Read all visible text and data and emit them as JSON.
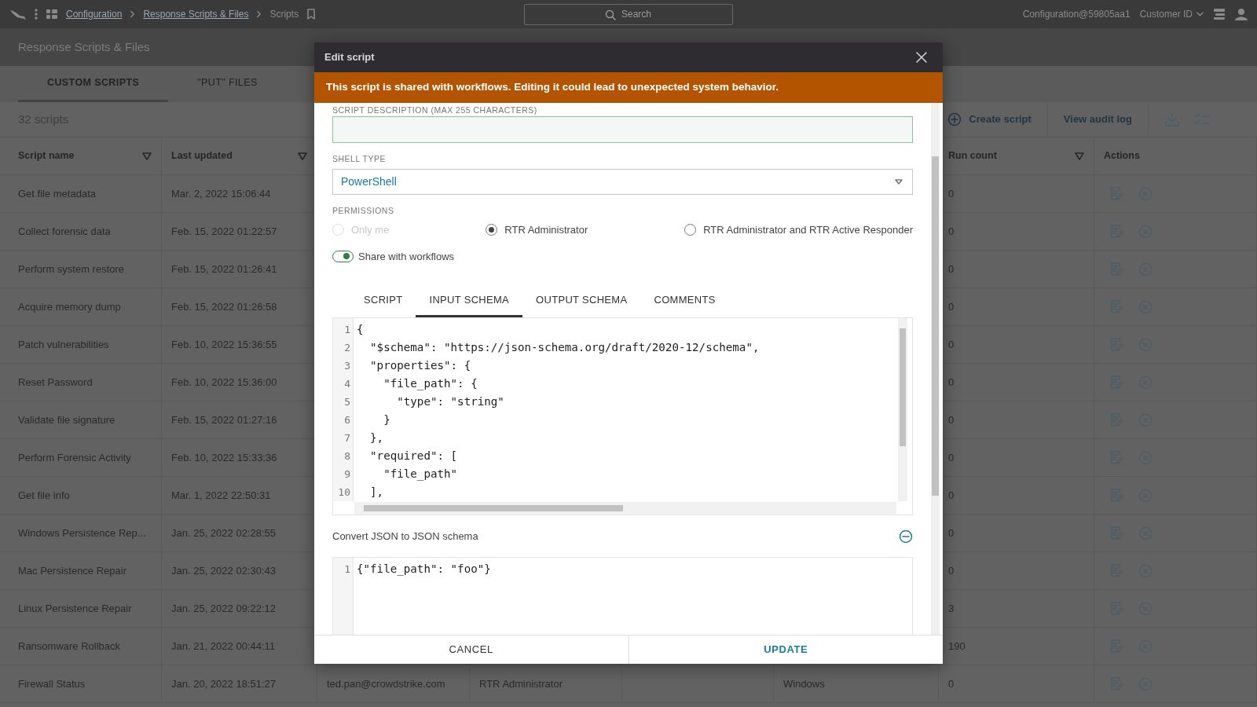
{
  "top_bar": {
    "breadcrumb": [
      {
        "label": "Configuration",
        "link": true
      },
      {
        "label": "Response Scripts & Files",
        "link": true
      },
      {
        "label": "Scripts",
        "link": false
      }
    ],
    "search": {
      "placeholder": "Search"
    },
    "account": "Configuration@59805aa1",
    "customer_menu": "Customer ID"
  },
  "page_title": "Response Scripts & Files",
  "tabs": [
    {
      "label": "CUSTOM SCRIPTS",
      "selected": true
    },
    {
      "label": "\"PUT\" FILES",
      "selected": false
    }
  ],
  "toolbar": {
    "count": "32 scripts",
    "create": "Create script",
    "audit": "View audit log"
  },
  "table": {
    "columns": [
      {
        "label": "Script name",
        "sortable": true
      },
      {
        "label": "Last updated",
        "sortable": true
      },
      {
        "label": "Run count",
        "sortable": true
      },
      {
        "label": "Actions",
        "sortable": false
      }
    ],
    "rows": [
      {
        "script_name": "Get file metadata",
        "last_updated": "Mar. 2, 2022 15:06:44",
        "run_count": "0"
      },
      {
        "script_name": "Collect forensic data",
        "last_updated": "Feb. 15, 2022 01:22:57",
        "run_count": "0"
      },
      {
        "script_name": "Perform system restore",
        "last_updated": "Feb. 15, 2022 01:26:41",
        "run_count": "0"
      },
      {
        "script_name": "Acquire memory dump",
        "last_updated": "Feb. 15, 2022 01:26:58",
        "run_count": "0"
      },
      {
        "script_name": "Patch vulnerabilities",
        "last_updated": "Feb. 10, 2022 15:36:55",
        "run_count": "0"
      },
      {
        "script_name": "Reset Password",
        "last_updated": "Feb. 10, 2022 15:36:00",
        "run_count": "0"
      },
      {
        "script_name": "Validate file signature",
        "last_updated": "Feb. 15, 2022 01:27:16",
        "run_count": "0"
      },
      {
        "script_name": "Perform Forensic Activity",
        "last_updated": "Feb. 10, 2022 15:33:36",
        "run_count": "0"
      },
      {
        "script_name": "Get file info",
        "last_updated": "Mar. 1, 2022 22:50:31",
        "run_count": "0"
      },
      {
        "script_name": "Windows Persistence Rep...",
        "last_updated": "Jan. 25, 2022 02:28:55",
        "run_count": "0"
      },
      {
        "script_name": "Mac Persistence Repair",
        "last_updated": "Jan. 25, 2022 02:30:43",
        "run_count": "0"
      },
      {
        "script_name": "Linux Persistence Repair",
        "last_updated": "Jan. 25, 2022 09:22:12",
        "run_count": "3"
      },
      {
        "script_name": "Ransomware Rollback",
        "last_updated": "Jan. 21, 2022 00:44:11",
        "run_count": "190"
      },
      {
        "script_name": "Firewall Status",
        "last_updated": "Jan. 20, 2022 18:51:27",
        "column_3": "ted.pan@crowdstrike.com",
        "column_4": "RTR Administrator",
        "column_6": "Windows",
        "run_count": "0"
      }
    ]
  },
  "modal": {
    "title": "Edit script",
    "warning": "This script is shared with workflows. Editing it could lead to unexpected system behavior.",
    "description": {
      "label": "SCRIPT DESCRIPTION (MAX 255 CHARACTERS)"
    },
    "shell": {
      "label": "SHELL TYPE",
      "value": "PowerShell"
    },
    "permissions": {
      "label": "PERMISSIONS",
      "options": [
        {
          "label": "Only me",
          "selected": false,
          "disabled": true
        },
        {
          "label": "RTR Administrator",
          "selected": true,
          "disabled": false
        },
        {
          "label": "RTR Administrator and RTR Active Responder",
          "selected": false,
          "disabled": false
        }
      ]
    },
    "share": {
      "label": "Share with workflows",
      "on": true
    },
    "tabs": [
      {
        "label": "SCRIPT",
        "selected": false
      },
      {
        "label": "INPUT SCHEMA",
        "selected": true
      },
      {
        "label": "OUTPUT SCHEMA",
        "selected": false
      },
      {
        "label": "COMMENTS",
        "selected": false
      }
    ],
    "editor": {
      "lines": [
        {
          "number": "1",
          "text": "{"
        },
        {
          "number": "2",
          "text": "  \"$schema\": \"https://json-schema.org/draft/2020-12/schema\","
        },
        {
          "number": "3",
          "text": "  \"properties\": {"
        },
        {
          "number": "4",
          "text": "    \"file_path\": {"
        },
        {
          "number": "5",
          "text": "      \"type\": \"string\""
        },
        {
          "number": "6",
          "text": "    }"
        },
        {
          "number": "7",
          "text": "  },"
        },
        {
          "number": "8",
          "text": "  \"required\": ["
        },
        {
          "number": "9",
          "text": "    \"file_path\""
        },
        {
          "number": "10",
          "text": "  ],"
        }
      ]
    },
    "convert": {
      "label": "Convert JSON to JSON schema",
      "expanded": true
    },
    "sample_editor": {
      "lines": [
        {
          "number": "1",
          "text": "{\"file_path\": \"foo\"}"
        }
      ]
    },
    "buttons": [
      {
        "label": "CANCEL",
        "kind": "secondary"
      },
      {
        "label": "UPDATE",
        "kind": "primary"
      }
    ]
  }
}
